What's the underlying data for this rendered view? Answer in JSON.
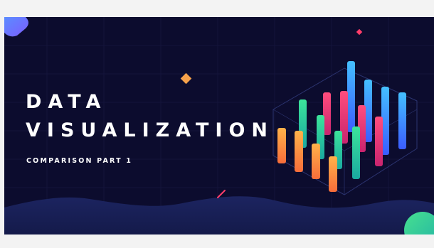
{
  "banner": {
    "title_line_1": "DATA",
    "title_line_2": "VISUALIZATION",
    "subtitle": "COMPARISON PART 1"
  },
  "colors": {
    "background": "#0c0c2e",
    "page": "#f3f3f3",
    "accent_orange": "#f7a24b",
    "accent_red": "#ff3d6a",
    "accent_green": "#35d49a",
    "accent_blue": "#3fa8ff",
    "accent_purple": "#7c5cff"
  },
  "illustration": {
    "name": "3d-bar-cluster"
  }
}
